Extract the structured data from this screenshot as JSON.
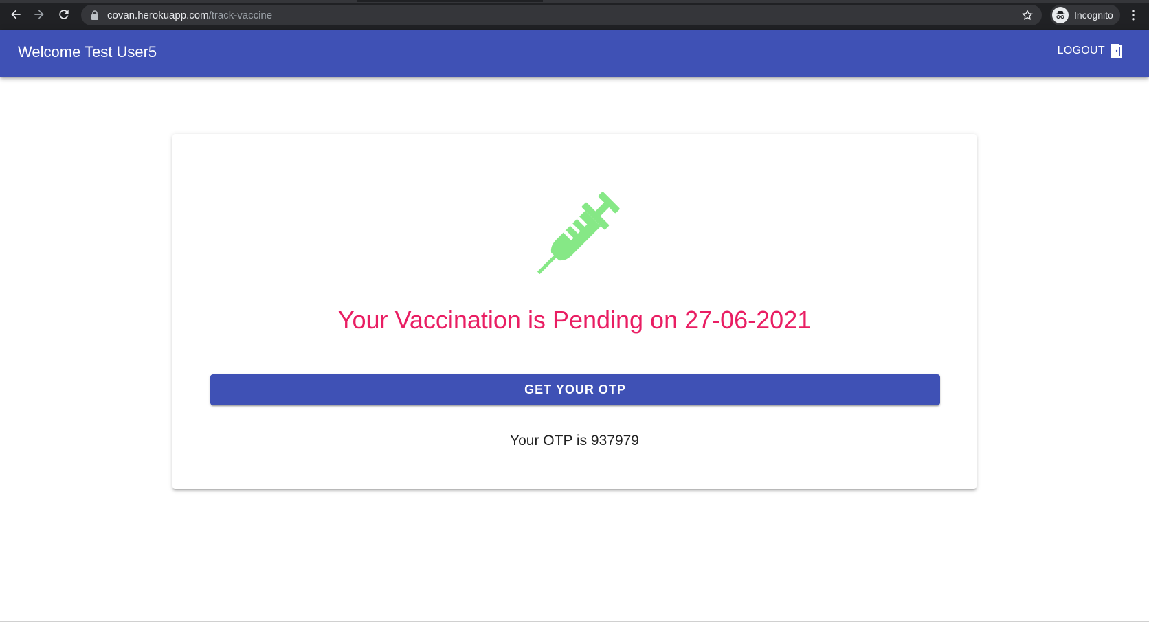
{
  "browser": {
    "url_host": "covan.herokuapp.com",
    "url_path": "/track-vaccine",
    "profile_label": "Incognito",
    "icons": [
      "back-icon",
      "forward-icon",
      "reload-icon",
      "lock-icon",
      "star-icon",
      "incognito-icon",
      "more-vert-icon"
    ]
  },
  "app_bar": {
    "title": "Welcome Test User5",
    "logout_label": "LOGOUT",
    "color": "#3f51b5"
  },
  "card": {
    "icon": "syringe-icon",
    "icon_color": "#86e886",
    "status_text": "Your Vaccination is Pending on 27-06-2021",
    "status_color": "#e91e63",
    "button_label": "GET YOUR OTP",
    "otp_text": "Your OTP is 937979"
  }
}
